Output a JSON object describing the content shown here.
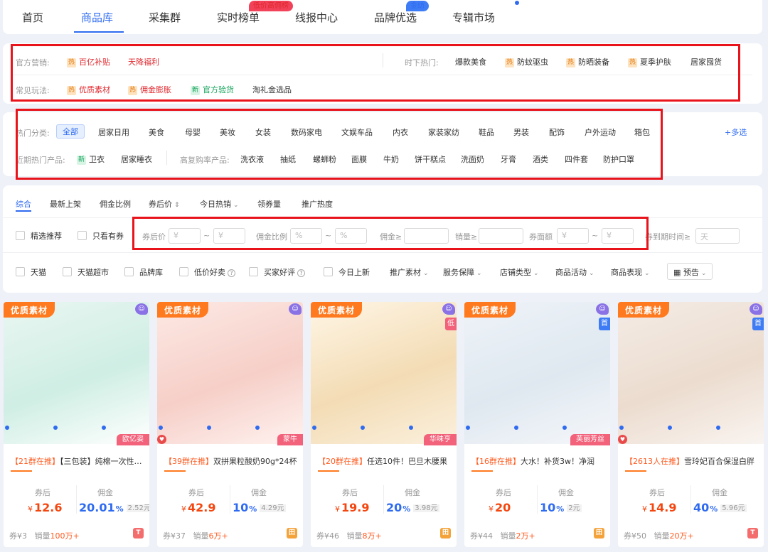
{
  "nav": {
    "tabs": [
      "首页",
      "商品库",
      "采集群",
      "实时榜单",
      "线报中心",
      "品牌优选",
      "专辑市场"
    ],
    "badge_rank": "低价高佣榜",
    "badge_brand": "金纺"
  },
  "marketing": {
    "official_label": "官方营销:",
    "official": [
      "百亿补贴",
      "天降福利"
    ],
    "trending_label": "时下热门:",
    "trending": [
      "爆款美食",
      "防蚊驱虫",
      "防晒装备",
      "夏季护肤",
      "居家囤货"
    ],
    "common_label": "常见玩法:",
    "common": [
      "优质素材",
      "佣金膨胀",
      "官方验货",
      "淘礼金选品"
    ]
  },
  "category": {
    "hot_label": "热门分类:",
    "items": [
      "全部",
      "居家日用",
      "美食",
      "母婴",
      "美妆",
      "女装",
      "数码家电",
      "文娱车品",
      "内衣",
      "家装家纺",
      "鞋品",
      "男装",
      "配饰",
      "户外运动",
      "箱包"
    ],
    "more": "+多选",
    "recent_label": "近期热门产品:",
    "recent": [
      "卫衣",
      "居家睡衣"
    ],
    "repurchase_label": "高复购率产品:",
    "repurchase": [
      "洗衣液",
      "抽纸",
      "螺蛳粉",
      "面膜",
      "牛奶",
      "饼干糕点",
      "洗面奶",
      "牙膏",
      "酒类",
      "四件套",
      "防护口罩"
    ]
  },
  "sort": [
    "综合",
    "最新上架",
    "佣金比例",
    "券后价",
    "今日热销",
    "领券量",
    "推广热度"
  ],
  "filters": {
    "featured": "精选推荐",
    "coupon_only": "只看有券",
    "price_after_coupon": "券后价",
    "commission_ratio": "佣金比例",
    "commission_min": "佣金≥",
    "sales_min": "销量≥",
    "coupon_amount": "券面额",
    "coupon_expire": "券到期时间≥",
    "yen_placeholder": "¥",
    "pct_placeholder": "%",
    "day_placeholder": "天",
    "tilde": "~"
  },
  "filters2": {
    "checks": [
      "天猫",
      "天猫超市",
      "品牌库",
      "低价好卖",
      "买家好评",
      "今日上新"
    ],
    "dropdowns": [
      "推广素材",
      "服务保障",
      "店铺类型",
      "商品活动",
      "商品表现"
    ],
    "preview": "预告"
  },
  "card_labels": {
    "quality": "优质素材",
    "after_coupon": "券后",
    "commission": "佣金",
    "yen": "¥",
    "sales_prefix": "销量",
    "pct": "%"
  },
  "products": [
    {
      "group": "【21群在推】",
      "title": "【三包装】纯棉一次性洗脸巾",
      "price": "12.6",
      "rate": "20.01",
      "amount": "2.52元",
      "coupon": "券¥3",
      "sales": "100万+",
      "brand": "欧亿姿",
      "brand_color": "#f2627b",
      "corner": "☺",
      "side": "",
      "side_color": "",
      "shop": "T",
      "shop_color": "#f46d6d"
    },
    {
      "group": "【39群在推】",
      "title": "双拼果粒酸奶90g*24杯",
      "price": "42.9",
      "rate": "10",
      "amount": "4.29元",
      "coupon": "券¥37",
      "sales": "6万+",
      "brand": "蒙牛",
      "brand_color": "#f2627b",
      "corner": "☺",
      "side": "",
      "side_color": "",
      "shop": "田",
      "shop_color": "#f4a33a"
    },
    {
      "group": "【20群在推】",
      "title": "任选10件！巴旦木腰果",
      "price": "19.9",
      "rate": "20",
      "amount": "3.98元",
      "coupon": "券¥46",
      "sales": "8万+",
      "brand": "华味亨",
      "brand_color": "#f2627b",
      "corner": "☺",
      "side": "低",
      "side_color": "#f2627b",
      "shop": "田",
      "shop_color": "#f4a33a"
    },
    {
      "group": "【16群在推】",
      "title": "大水！补货3w！净润",
      "price": "20",
      "rate": "10",
      "amount": "2元",
      "coupon": "券¥44",
      "sales": "2万+",
      "brand": "芙丽芳丝",
      "brand_color": "#f2627b",
      "corner": "☺",
      "side": "首",
      "side_color": "#3d7cf5",
      "shop": "田",
      "shop_color": "#f4a33a"
    },
    {
      "group": "【2613人在推】",
      "title": "雪玲妃百合保湿白胖",
      "price": "14.9",
      "rate": "40",
      "amount": "5.96元",
      "coupon": "券¥50",
      "sales": "20万+",
      "brand": "",
      "brand_color": "",
      "corner": "☺",
      "side": "首",
      "side_color": "#3d7cf5",
      "shop": "T",
      "shop_color": "#f46d6d"
    }
  ],
  "colors": {
    "accent": "#2f6bf0",
    "highlight_box": "#e8131b",
    "price": "#f4460f",
    "badge": "#ff7a1f"
  }
}
